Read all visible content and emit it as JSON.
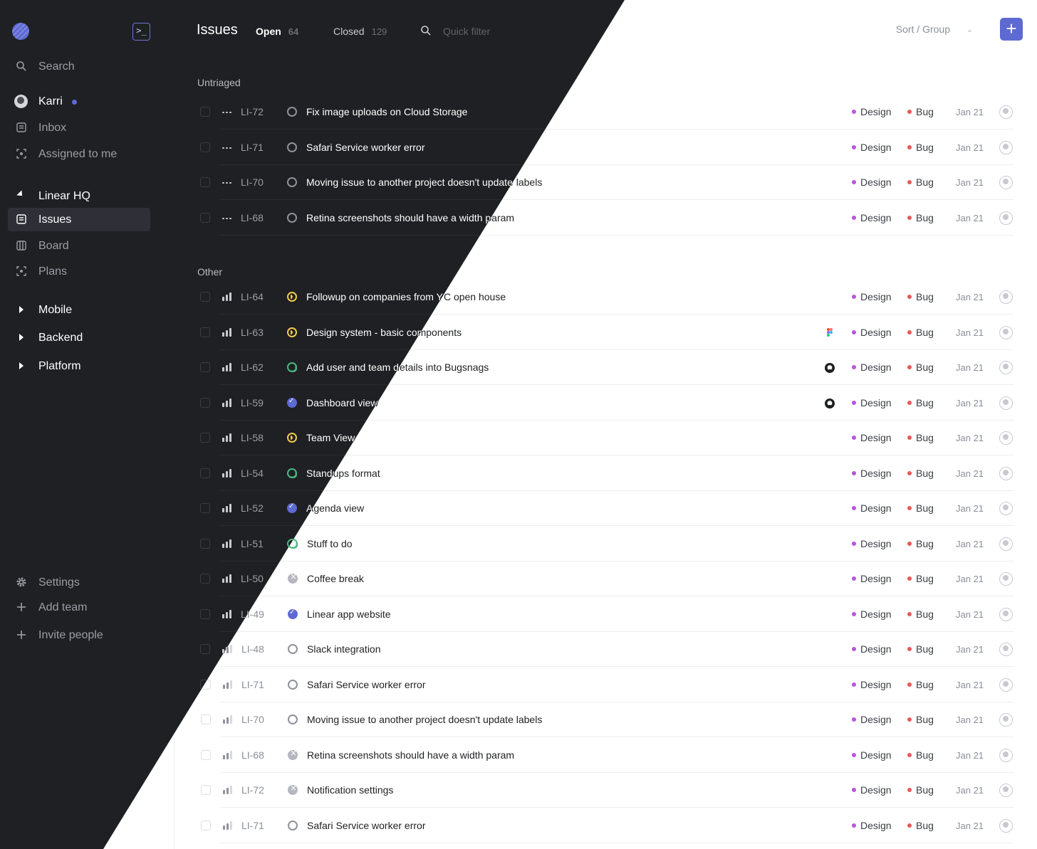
{
  "header": {
    "title": "Issues",
    "tabs": [
      {
        "label": "Open",
        "count": "64"
      },
      {
        "label": "Closed",
        "count": "129"
      }
    ],
    "quick_filter_placeholder": "Quick filter",
    "sort_group_label": "Sort / Group",
    "new_issue_label": "+"
  },
  "sidebar": {
    "command_label": ">_",
    "search_label": "Search",
    "user_name": "Karri",
    "inbox_label": "Inbox",
    "assigned_label": "Assigned to me",
    "team_name": "Linear HQ",
    "team_items": [
      {
        "label": "Issues"
      },
      {
        "label": "Board"
      },
      {
        "label": "Plans"
      }
    ],
    "projects": [
      {
        "label": "Mobile"
      },
      {
        "label": "Backend"
      },
      {
        "label": "Platform"
      }
    ],
    "settings_label": "Settings",
    "add_team_label": "Add team",
    "invite_label": "Invite people"
  },
  "groups": [
    {
      "title": "Untriaged"
    },
    {
      "title": "Other"
    }
  ],
  "labels": {
    "design": "Design",
    "bug": "Bug"
  },
  "colors": {
    "design": "#bb52e0",
    "bug": "#eb5757",
    "accent": "#5e6ad2",
    "dark_bg": "#1f2023"
  },
  "issues": [
    {
      "id": "LI-72",
      "title": "Fix image uploads on Cloud Storage",
      "status": "backlog",
      "priority": "none",
      "date": "Jan 21",
      "group": "Untriaged"
    },
    {
      "id": "LI-71",
      "title": "Safari Service worker error",
      "status": "backlog",
      "priority": "none",
      "date": "Jan 21",
      "group": "Untriaged"
    },
    {
      "id": "LI-70",
      "title": "Moving issue to another project doesn't update labels",
      "status": "backlog",
      "priority": "none",
      "date": "Jan 21",
      "group": "Untriaged"
    },
    {
      "id": "LI-68",
      "title": "Retina screenshots should have a width param",
      "status": "backlog",
      "priority": "none",
      "date": "Jan 21",
      "group": "Untriaged"
    },
    {
      "id": "LI-64",
      "title": "Followup on companies from YC open house",
      "status": "in-progress",
      "priority": "high",
      "date": "Jan 21",
      "group": "Other"
    },
    {
      "id": "LI-63",
      "title": "Design system - basic components",
      "status": "in-progress",
      "priority": "high",
      "date": "Jan 21",
      "integration": "figma-icon",
      "group": "Other"
    },
    {
      "id": "LI-62",
      "title": "Add user and team details into Bugsnags",
      "status": "in-review",
      "priority": "high",
      "date": "Jan 21",
      "integration": "github-icon",
      "group": "Other"
    },
    {
      "id": "LI-59",
      "title": "Dashboard view",
      "status": "done",
      "priority": "high",
      "date": "Jan 21",
      "integration": "github-icon",
      "group": "Other"
    },
    {
      "id": "LI-58",
      "title": "Team View",
      "status": "in-progress",
      "priority": "high",
      "date": "Jan 21",
      "group": "Other"
    },
    {
      "id": "LI-54",
      "title": "Standups format",
      "status": "in-review",
      "priority": "high",
      "date": "Jan 21",
      "group": "Other"
    },
    {
      "id": "LI-52",
      "title": "Agenda view",
      "status": "done",
      "priority": "high",
      "date": "Jan 21",
      "group": "Other"
    },
    {
      "id": "LI-51",
      "title": "Stuff to do",
      "status": "in-review",
      "priority": "high",
      "date": "Jan 21",
      "group": "Other"
    },
    {
      "id": "LI-50",
      "title": "Coffee break",
      "status": "canceled",
      "priority": "high",
      "date": "Jan 21",
      "group": "Other"
    },
    {
      "id": "LI-49",
      "title": "Linear app website",
      "status": "done",
      "priority": "high",
      "date": "Jan 21",
      "group": "Other"
    },
    {
      "id": "LI-48",
      "title": "Slack integration",
      "status": "backlog",
      "priority": "medium",
      "date": "Jan 21",
      "group": "Other"
    },
    {
      "id": "LI-71",
      "title": "Safari Service worker error",
      "status": "backlog",
      "priority": "medium",
      "date": "Jan 21",
      "group": "Other"
    },
    {
      "id": "LI-70",
      "title": "Moving issue to another project doesn't update labels",
      "status": "backlog",
      "priority": "medium",
      "date": "Jan 21",
      "group": "Other"
    },
    {
      "id": "LI-68",
      "title": "Retina screenshots should have a width param",
      "status": "canceled",
      "priority": "medium",
      "date": "Jan 21",
      "group": "Other"
    },
    {
      "id": "LI-72",
      "title": "Notification settings",
      "status": "canceled",
      "priority": "medium",
      "date": "Jan 21",
      "group": "Other"
    },
    {
      "id": "LI-71",
      "title": "Safari Service worker error",
      "status": "backlog",
      "priority": "medium",
      "date": "Jan 21",
      "group": "Other"
    }
  ]
}
